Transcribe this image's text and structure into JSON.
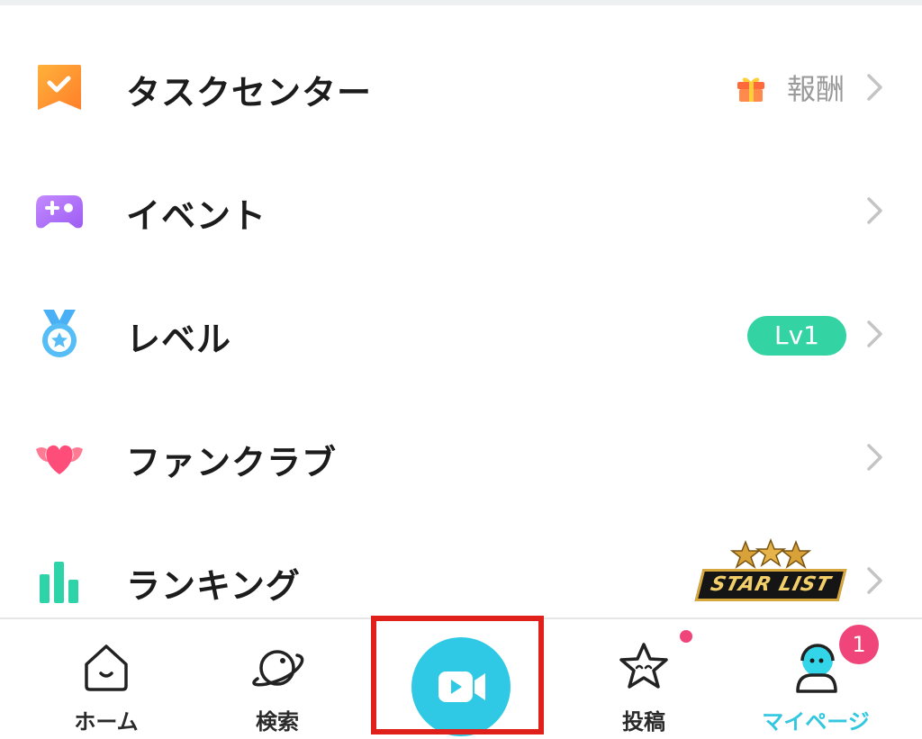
{
  "menu": {
    "items": [
      {
        "label": "タスクセンター",
        "icon": "task-flag-icon",
        "extra": "報酬",
        "extra_icon": "gift-icon"
      },
      {
        "label": "イベント",
        "icon": "gamepad-icon"
      },
      {
        "label": "レベル",
        "icon": "medal-icon",
        "badge": "Lv1"
      },
      {
        "label": "ファンクラブ",
        "icon": "winged-heart-icon"
      },
      {
        "label": "ランキング",
        "icon": "bar-chart-icon",
        "logo_text": "STAR LIST"
      }
    ]
  },
  "tabbar": {
    "tabs": [
      {
        "label": "ホーム",
        "icon": "home-icon"
      },
      {
        "label": "検索",
        "icon": "planet-icon"
      },
      {
        "label": "",
        "icon": "video-camera-icon"
      },
      {
        "label": "投稿",
        "icon": "star-face-icon",
        "dot": true
      },
      {
        "label": "マイページ",
        "icon": "user-avatar-icon",
        "badge": "1",
        "active": true
      }
    ]
  },
  "colors": {
    "accent": "#33c7e0",
    "level_badge": "#33d3a3",
    "notification": "#f0457a",
    "highlight_box": "#e0201a"
  }
}
